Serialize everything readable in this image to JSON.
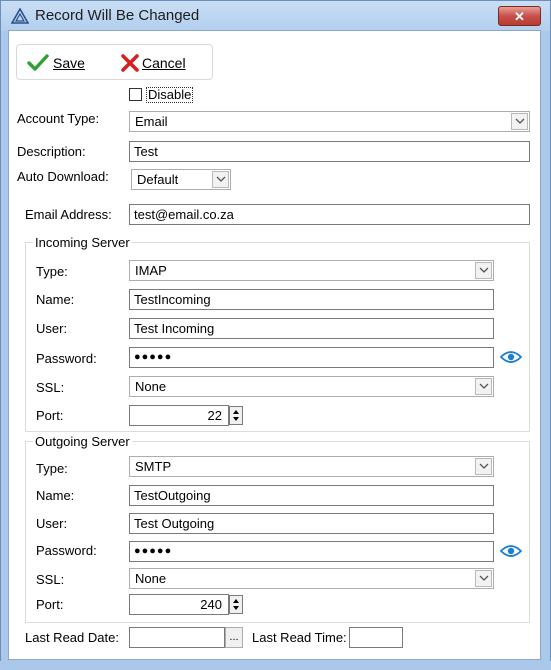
{
  "window": {
    "title": "Record Will Be Changed",
    "close_label": "✕"
  },
  "toolbar": {
    "save_label": "Save",
    "cancel_label": "Cancel"
  },
  "disable": {
    "label": "Disable",
    "checked": false
  },
  "account_type": {
    "label": "Account Type:",
    "value": "Email"
  },
  "description": {
    "label": "Description:",
    "value": "Test"
  },
  "auto_download": {
    "label": "Auto Download:",
    "value": "Default"
  },
  "email_address": {
    "label": "Email Address:",
    "value": "test@email.co.za"
  },
  "incoming": {
    "title": "Incoming Server",
    "type_label": "Type:",
    "type_value": "IMAP",
    "name_label": "Name:",
    "name_value": "TestIncoming",
    "user_label": "User:",
    "user_value": "Test Incoming",
    "password_label": "Password:",
    "password_value": "●●●●●",
    "ssl_label": "SSL:",
    "ssl_value": "None",
    "port_label": "Port:",
    "port_value": "22"
  },
  "outgoing": {
    "title": "Outgoing Server",
    "type_label": "Type:",
    "type_value": "SMTP",
    "name_label": "Name:",
    "name_value": "TestOutgoing",
    "user_label": "User:",
    "user_value": "Test Outgoing",
    "password_label": "Password:",
    "password_value": "●●●●●",
    "ssl_label": "SSL:",
    "ssl_value": "None",
    "port_label": "Port:",
    "port_value": "240"
  },
  "last_read": {
    "date_label": "Last Read Date:",
    "date_value": "",
    "date_button": "...",
    "time_label": "Last Read Time:",
    "time_value": ""
  },
  "colors": {
    "titlebar": "#b9d3ef",
    "close_button": "#c75050",
    "save_icon": "#2fa12f",
    "cancel_icon": "#d42020",
    "eye_icon": "#1e7fd0"
  }
}
